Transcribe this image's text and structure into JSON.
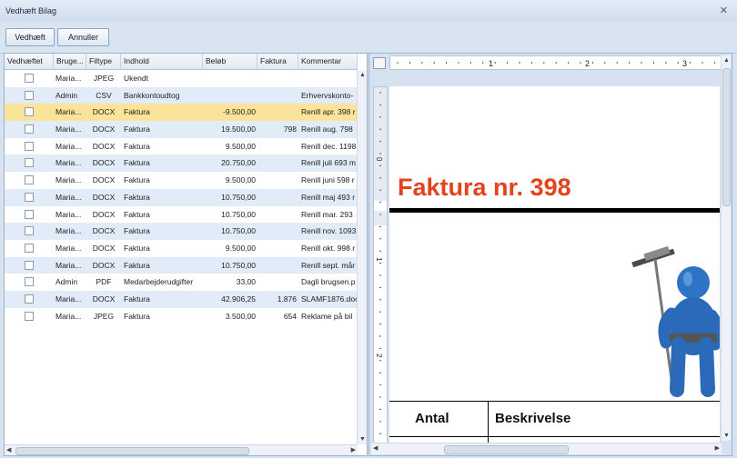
{
  "window": {
    "title": "Vedhæft Bilag",
    "close_glyph": "✕"
  },
  "toolbar": {
    "attach_label": "Vedhæft",
    "cancel_label": "Annuller"
  },
  "grid": {
    "columns": [
      "Vedhæftet",
      "Bruge...",
      "Filtype",
      "Indhold",
      "Beløb",
      "Faktura",
      "Kommentar"
    ],
    "rows": [
      {
        "user": "Maria...",
        "type": "JPEG",
        "content": "Ukendt",
        "amount": "",
        "invoice": "",
        "comment": ""
      },
      {
        "user": "Admin",
        "type": "CSV",
        "content": "Bankkontoudtog",
        "amount": "",
        "invoice": "",
        "comment": "Erhvervskonto-"
      },
      {
        "user": "Maria...",
        "type": "DOCX",
        "content": "Faktura",
        "amount": "-9.500,00",
        "invoice": "",
        "comment": "Renill apr. 398 r"
      },
      {
        "user": "Maria...",
        "type": "DOCX",
        "content": "Faktura",
        "amount": "19.500,00",
        "invoice": "798",
        "comment": "Renill aug. 798"
      },
      {
        "user": "Maria...",
        "type": "DOCX",
        "content": "Faktura",
        "amount": "9.500,00",
        "invoice": "",
        "comment": "Renill dec. 1198"
      },
      {
        "user": "Maria...",
        "type": "DOCX",
        "content": "Faktura",
        "amount": "20.750,00",
        "invoice": "",
        "comment": "Renill juli 693 m"
      },
      {
        "user": "Maria...",
        "type": "DOCX",
        "content": "Faktura",
        "amount": "9.500,00",
        "invoice": "",
        "comment": "Renill juni 598 r"
      },
      {
        "user": "Maria...",
        "type": "DOCX",
        "content": "Faktura",
        "amount": "10.750,00",
        "invoice": "",
        "comment": "Renill maj 493 r"
      },
      {
        "user": "Maria...",
        "type": "DOCX",
        "content": "Faktura",
        "amount": "10.750,00",
        "invoice": "",
        "comment": "Renill mar. 293"
      },
      {
        "user": "Maria...",
        "type": "DOCX",
        "content": "Faktura",
        "amount": "10.750,00",
        "invoice": "",
        "comment": "Renill nov. 1093"
      },
      {
        "user": "Maria...",
        "type": "DOCX",
        "content": "Faktura",
        "amount": "9.500,00",
        "invoice": "",
        "comment": "Renill okt. 998 r"
      },
      {
        "user": "Maria...",
        "type": "DOCX",
        "content": "Faktura",
        "amount": "10.750,00",
        "invoice": "",
        "comment": "Renill sept. mår"
      },
      {
        "user": "Admin",
        "type": "PDF",
        "content": "Medarbejderudgifter",
        "amount": "33,00",
        "invoice": "",
        "comment": "Dagli brugsen.p"
      },
      {
        "user": "Maria...",
        "type": "DOCX",
        "content": "Faktura",
        "amount": "42.906,25",
        "invoice": "1.876",
        "comment": "SLAMF1876.doc"
      },
      {
        "user": "Maria...",
        "type": "JPEG",
        "content": "Faktura",
        "amount": "3.500,00",
        "invoice": "654",
        "comment": "Reklame på bil"
      }
    ],
    "selected_row": 2
  },
  "viewer": {
    "ruler_numbers": [
      "1",
      "2",
      "3"
    ],
    "ruler_left_numbers": [
      "0",
      "1",
      "2"
    ],
    "invoice_title": "Faktura nr. 398",
    "table_headers": [
      "Antal",
      "Beskrivelse"
    ],
    "accent_color": "#e4431c"
  }
}
